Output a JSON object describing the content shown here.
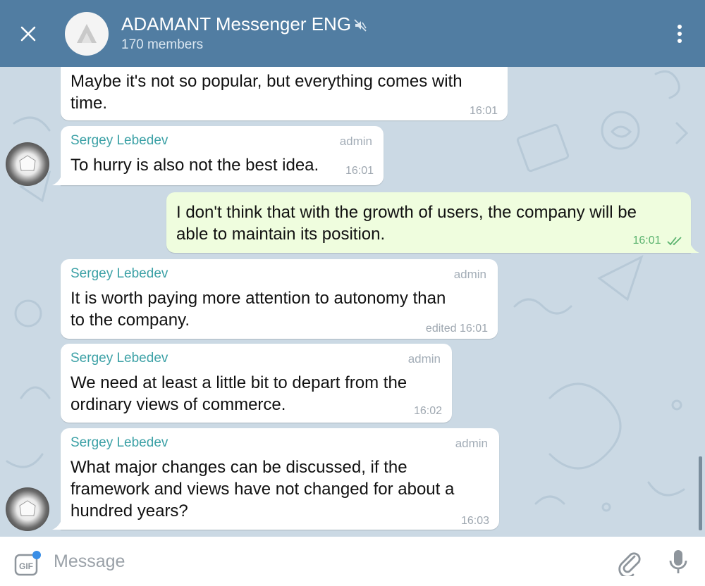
{
  "header": {
    "title": "ADAMANT Messenger ENG",
    "subtitle": "170 members",
    "colors": {
      "background": "#517da2",
      "text": "#ffffff"
    },
    "icons": {
      "close": "close-icon",
      "muted": "muted-icon",
      "menu": "more-vert-icon",
      "avatar": "adamant-logo-icon"
    }
  },
  "messages": [
    {
      "text_lines": [
        "Maybe it's not so popular, but everything comes with",
        "time."
      ],
      "time": "16:01"
    },
    {
      "sender": "Sergey Lebedev",
      "role": "admin",
      "text_lines": [
        "To hurry is also not the best idea."
      ],
      "time": "16:01"
    },
    {
      "outgoing": true,
      "text_lines": [
        "I don't think that with the growth of users, the company will be",
        "able to maintain its position."
      ],
      "time": "16:01",
      "status": "read"
    },
    {
      "sender": "Sergey Lebedev",
      "role": "admin",
      "text_lines": [
        "It is worth paying more attention to autonomy than",
        "to the company."
      ],
      "time": "edited 16:01"
    },
    {
      "sender": "Sergey Lebedev",
      "role": "admin",
      "text_lines": [
        "We need at least a little bit to depart from the",
        "ordinary views of commerce."
      ],
      "time": "16:02"
    },
    {
      "sender": "Sergey Lebedev",
      "role": "admin",
      "text_lines": [
        "What major changes can be discussed, if the",
        "framework and views have not changed for about a",
        "hundred years?"
      ],
      "time": "16:03"
    }
  ],
  "input": {
    "placeholder": "Message",
    "gif_label": "GIF",
    "icons": {
      "gif": "gif-icon",
      "attach": "attach-icon",
      "mic": "microphone-icon"
    }
  },
  "colors": {
    "chat_background": "#cbd9e4",
    "incoming_bubble": "#ffffff",
    "outgoing_bubble": "#effdde",
    "sender_name": "#3ca1a6",
    "outgoing_time": "#5bb36f"
  }
}
